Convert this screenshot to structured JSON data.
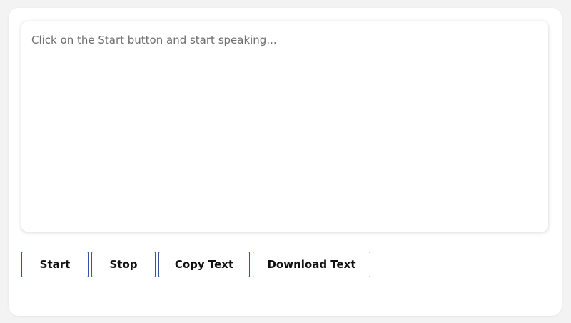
{
  "transcript": {
    "value": "",
    "placeholder": "Click on the Start button and start speaking..."
  },
  "buttons": {
    "start_label": "Start",
    "stop_label": "Stop",
    "copy_label": "Copy Text",
    "download_label": "Download Text"
  },
  "colors": {
    "button_border": "#3a4fa0",
    "page_background": "#f3f3f3",
    "card_background": "#ffffff"
  }
}
